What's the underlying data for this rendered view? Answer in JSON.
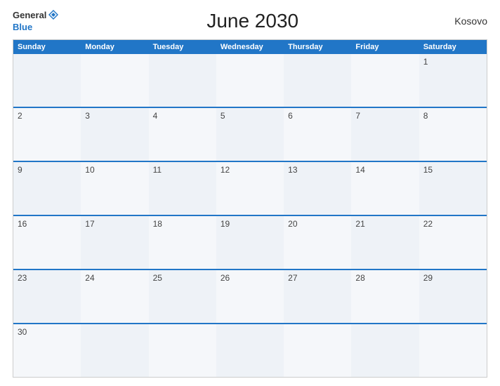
{
  "header": {
    "logo_general": "General",
    "logo_blue": "Blue",
    "title": "June 2030",
    "country": "Kosovo"
  },
  "days_of_week": [
    "Sunday",
    "Monday",
    "Tuesday",
    "Wednesday",
    "Thursday",
    "Friday",
    "Saturday"
  ],
  "weeks": [
    [
      {
        "date": "",
        "empty": true
      },
      {
        "date": "",
        "empty": true
      },
      {
        "date": "",
        "empty": true
      },
      {
        "date": "",
        "empty": true
      },
      {
        "date": "",
        "empty": true
      },
      {
        "date": "",
        "empty": true
      },
      {
        "date": "1"
      }
    ],
    [
      {
        "date": "2"
      },
      {
        "date": "3"
      },
      {
        "date": "4"
      },
      {
        "date": "5"
      },
      {
        "date": "6"
      },
      {
        "date": "7"
      },
      {
        "date": "8"
      }
    ],
    [
      {
        "date": "9"
      },
      {
        "date": "10"
      },
      {
        "date": "11"
      },
      {
        "date": "12"
      },
      {
        "date": "13"
      },
      {
        "date": "14"
      },
      {
        "date": "15"
      }
    ],
    [
      {
        "date": "16"
      },
      {
        "date": "17"
      },
      {
        "date": "18"
      },
      {
        "date": "19"
      },
      {
        "date": "20"
      },
      {
        "date": "21"
      },
      {
        "date": "22"
      }
    ],
    [
      {
        "date": "23"
      },
      {
        "date": "24"
      },
      {
        "date": "25"
      },
      {
        "date": "26"
      },
      {
        "date": "27"
      },
      {
        "date": "28"
      },
      {
        "date": "29"
      }
    ],
    [
      {
        "date": "30"
      },
      {
        "date": "",
        "empty": true
      },
      {
        "date": "",
        "empty": true
      },
      {
        "date": "",
        "empty": true
      },
      {
        "date": "",
        "empty": true
      },
      {
        "date": "",
        "empty": true
      },
      {
        "date": "",
        "empty": true
      }
    ]
  ]
}
